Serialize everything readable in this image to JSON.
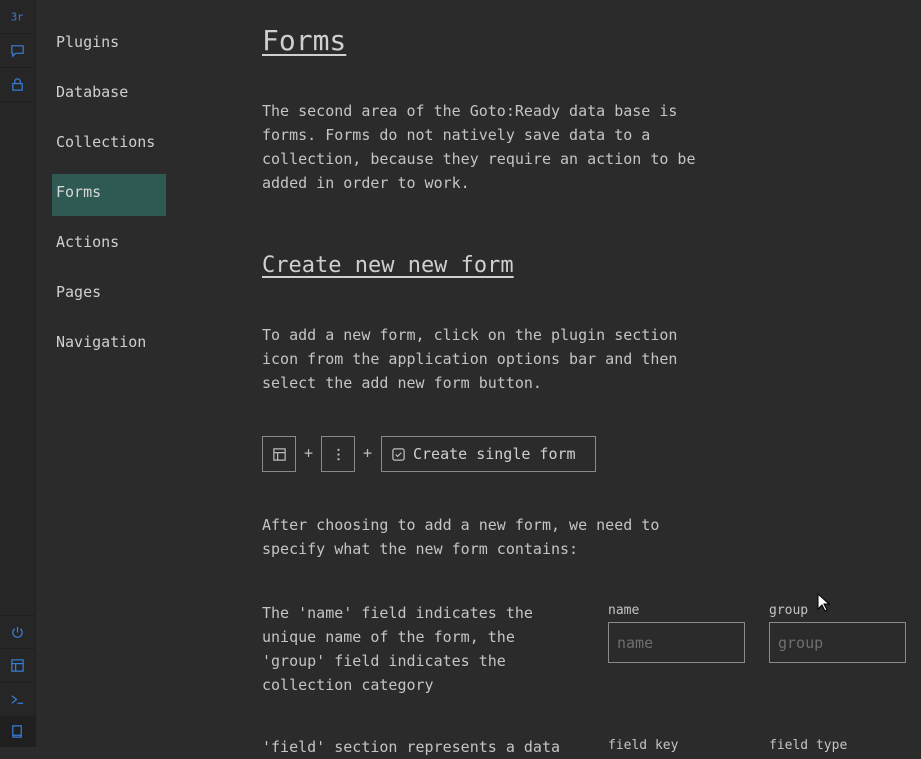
{
  "iconbar": {
    "top": [
      "brand-icon",
      "chat-icon",
      "lock-icon"
    ],
    "bottom": [
      "power-icon",
      "table-icon",
      "terminal-icon",
      "book-icon"
    ],
    "accent": "#3b7dd8"
  },
  "nav": {
    "items": [
      {
        "label": "Plugins"
      },
      {
        "label": "Database"
      },
      {
        "label": "Collections"
      },
      {
        "label": "Forms"
      },
      {
        "label": "Actions"
      },
      {
        "label": "Pages"
      },
      {
        "label": "Navigation"
      }
    ],
    "active_color": "#2e5a53"
  },
  "main": {
    "title": "Forms",
    "intro": [
      "The second area of the Goto:Ready data base is",
      "forms. Forms do not natively save data to a",
      "collection, because they require an action to be",
      "added in order to work."
    ],
    "section_title": "Create new new form",
    "how_to": [
      "To add a new form, click on the plugin section",
      "icon from the application options bar and then",
      "select the add new form button."
    ],
    "steps": {
      "plus1": "+",
      "plus2": "+",
      "create_button": "Create single form"
    },
    "after": [
      "After choosing to add a new form, we need to",
      "specify what the new form contains:"
    ],
    "name_group_desc": [
      "The 'name' field indicates the",
      "unique name of the form, the",
      "'group' field indicates the",
      "collection category"
    ],
    "fields": {
      "name_label": "name",
      "name_placeholder": "name",
      "group_label": "group",
      "group_placeholder": "group"
    },
    "next_desc": "'field' section represents a data",
    "next_fields": {
      "key_label": "field key",
      "type_label": "field type"
    }
  }
}
